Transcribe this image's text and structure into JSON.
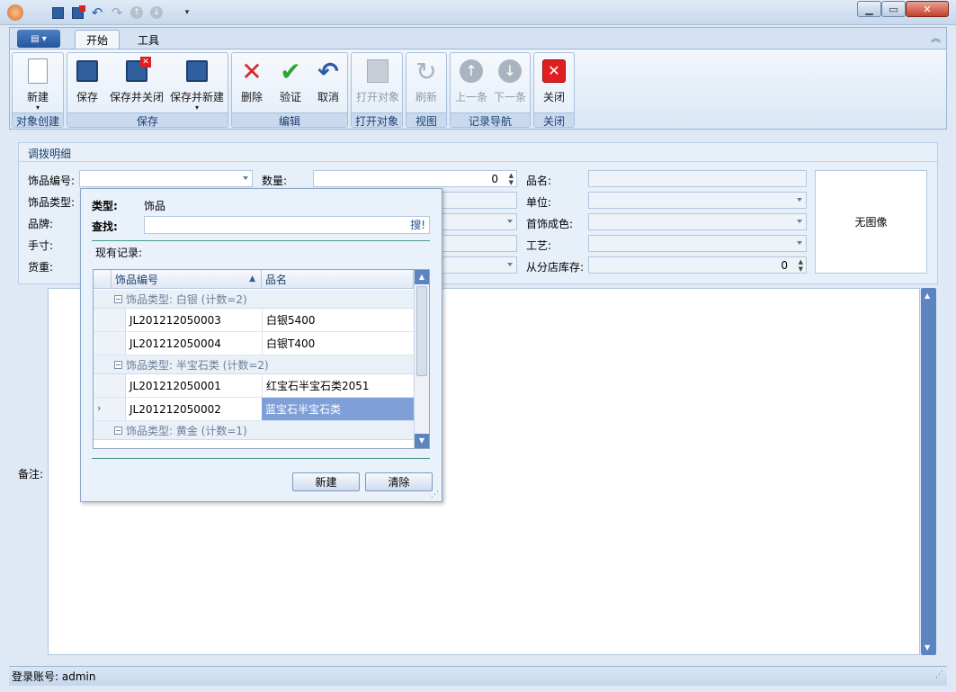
{
  "ribbon": {
    "tabs": [
      {
        "label": "开始"
      },
      {
        "label": "工具"
      }
    ],
    "groups": [
      {
        "label": "对象创建"
      },
      {
        "label": "保存"
      },
      {
        "label": "编辑"
      },
      {
        "label": "打开对象"
      },
      {
        "label": "视图"
      },
      {
        "label": "记录导航"
      },
      {
        "label": "关闭"
      }
    ],
    "buttons": {
      "new": "新建",
      "save": "保存",
      "save_close": "保存并关闭",
      "save_new": "保存并新建",
      "delete": "删除",
      "validate": "验证",
      "cancel": "取消",
      "open_object": "打开对象",
      "refresh": "刷新",
      "prev": "上一条",
      "next": "下一条",
      "close": "关闭"
    }
  },
  "form": {
    "title": "调拨明细",
    "labels": {
      "item_code": "饰品编号:",
      "item_type": "饰品类型:",
      "brand": "品牌:",
      "hand_size": "手寸:",
      "weight": "货重:",
      "quantity": "数量:",
      "name": "品名:",
      "unit": "单位:",
      "color": "首饰成色:",
      "craft": "工艺:",
      "branch_stock": "从分店库存:",
      "memo": "备注:"
    },
    "values": {
      "quantity": "0",
      "branch_stock": "0"
    },
    "no_image": "无图像"
  },
  "popup": {
    "type_label": "类型:",
    "type_value": "饰品",
    "search_label": "查找:",
    "search_button": "搜!",
    "records_label": "现有记录:",
    "grid": {
      "columns": [
        "饰品编号",
        "品名"
      ],
      "groups": [
        {
          "header": "饰品类型: 白银 (计数=2)",
          "rows": [
            [
              "JL201212050003",
              "白银5400"
            ],
            [
              "JL201212050004",
              "白银T400"
            ]
          ]
        },
        {
          "header": "饰品类型: 半宝石类 (计数=2)",
          "rows": [
            [
              "JL201212050001",
              "红宝石半宝石类2051"
            ],
            [
              "JL201212050002",
              "蓝宝石半宝石类"
            ]
          ]
        },
        {
          "header": "饰品类型: 黄金 (计数=1)",
          "rows": []
        }
      ]
    },
    "new_button": "新建",
    "clear_button": "清除"
  },
  "status": {
    "login": "登录账号: admin"
  },
  "colors": {
    "selected_row": "#7f9fd8",
    "accent": "#2456a0",
    "scrollbar": "#5b84c0"
  }
}
